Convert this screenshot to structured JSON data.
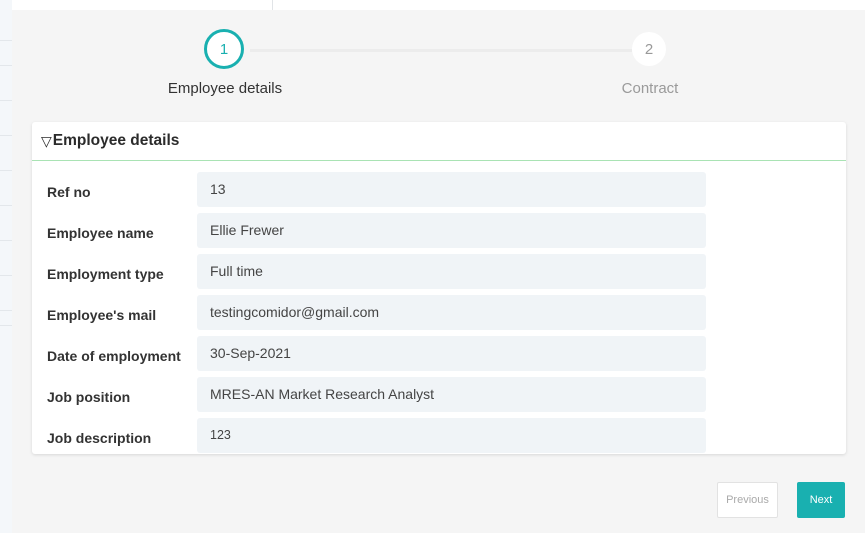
{
  "stepper": {
    "steps": [
      {
        "number": "1",
        "label": "Employee details",
        "active": true
      },
      {
        "number": "2",
        "label": "Contract",
        "active": false
      }
    ]
  },
  "section": {
    "title": "Employee details",
    "toggle_icon": "triangle-down-icon"
  },
  "fields": [
    {
      "label": "Ref no",
      "value": "13"
    },
    {
      "label": "Employee name",
      "value": "Ellie Frewer"
    },
    {
      "label": "Employment type",
      "value": "Full time"
    },
    {
      "label": "Employee's mail",
      "value": "testingcomidor@gmail.com"
    },
    {
      "label": "Date of employment",
      "value": "30-Sep-2021"
    },
    {
      "label": "Job position",
      "value": "MRES-AN Market Research Analyst"
    },
    {
      "label": "Job description",
      "value": "123"
    }
  ],
  "buttons": {
    "previous": "Previous",
    "next": "Next"
  },
  "colors": {
    "accent": "#19b0b0",
    "field_bg": "#f0f4f7",
    "header_rule": "#a9e3b4"
  }
}
